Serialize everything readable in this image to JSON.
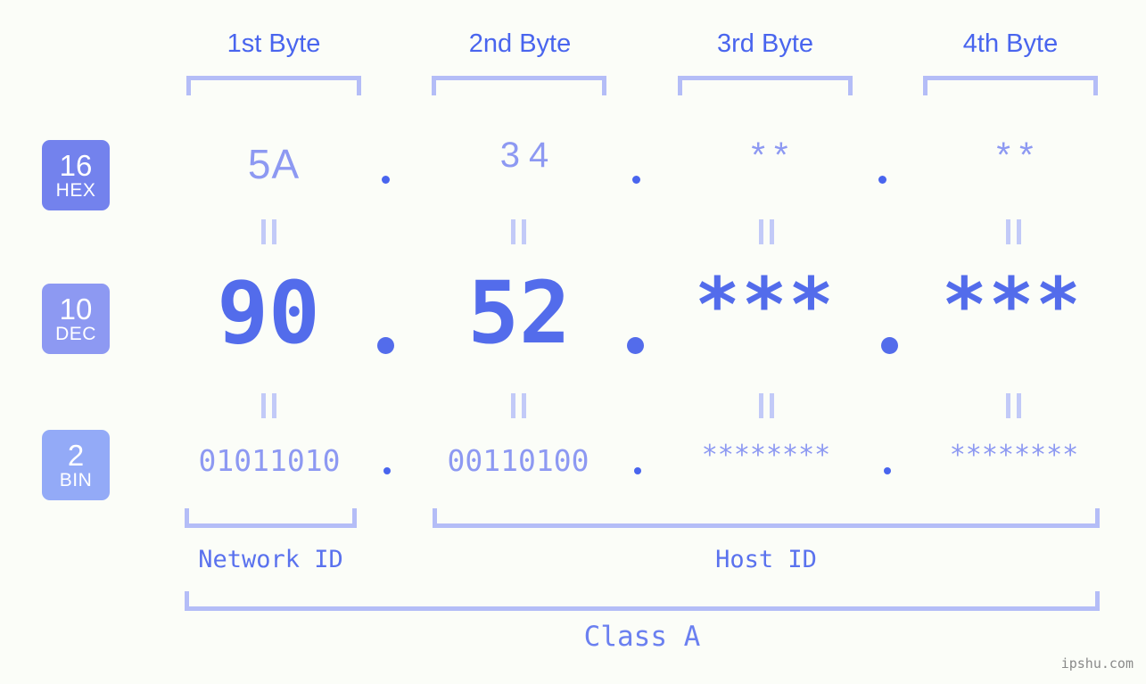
{
  "background_color": "#fbfdf8",
  "accent_color": "#536ceb",
  "byte_headers": [
    {
      "label": "1st Byte"
    },
    {
      "label": "2nd Byte"
    },
    {
      "label": "3rd Byte"
    },
    {
      "label": "4th Byte"
    }
  ],
  "rows": [
    {
      "badge_number": "16",
      "badge_name": "HEX",
      "badge_color": "#7382ed",
      "values": [
        "5A",
        "34",
        "**",
        "**"
      ],
      "separators": [
        ".",
        ".",
        "."
      ]
    },
    {
      "badge_number": "10",
      "badge_name": "DEC",
      "badge_color": "#8d99f2",
      "values": [
        "90",
        "52",
        "***",
        "***"
      ],
      "separators": [
        ".",
        ".",
        "."
      ]
    },
    {
      "badge_number": "2",
      "badge_name": "BIN",
      "badge_color": "#93aaf7",
      "values": [
        "01011010",
        "00110100",
        "********",
        "********"
      ],
      "separators": [
        ".",
        ".",
        "."
      ]
    }
  ],
  "equals_symbol": "=",
  "sections": {
    "network_id": "Network ID",
    "host_id": "Host ID",
    "class": "Class A"
  },
  "watermark": "ipshu.com"
}
